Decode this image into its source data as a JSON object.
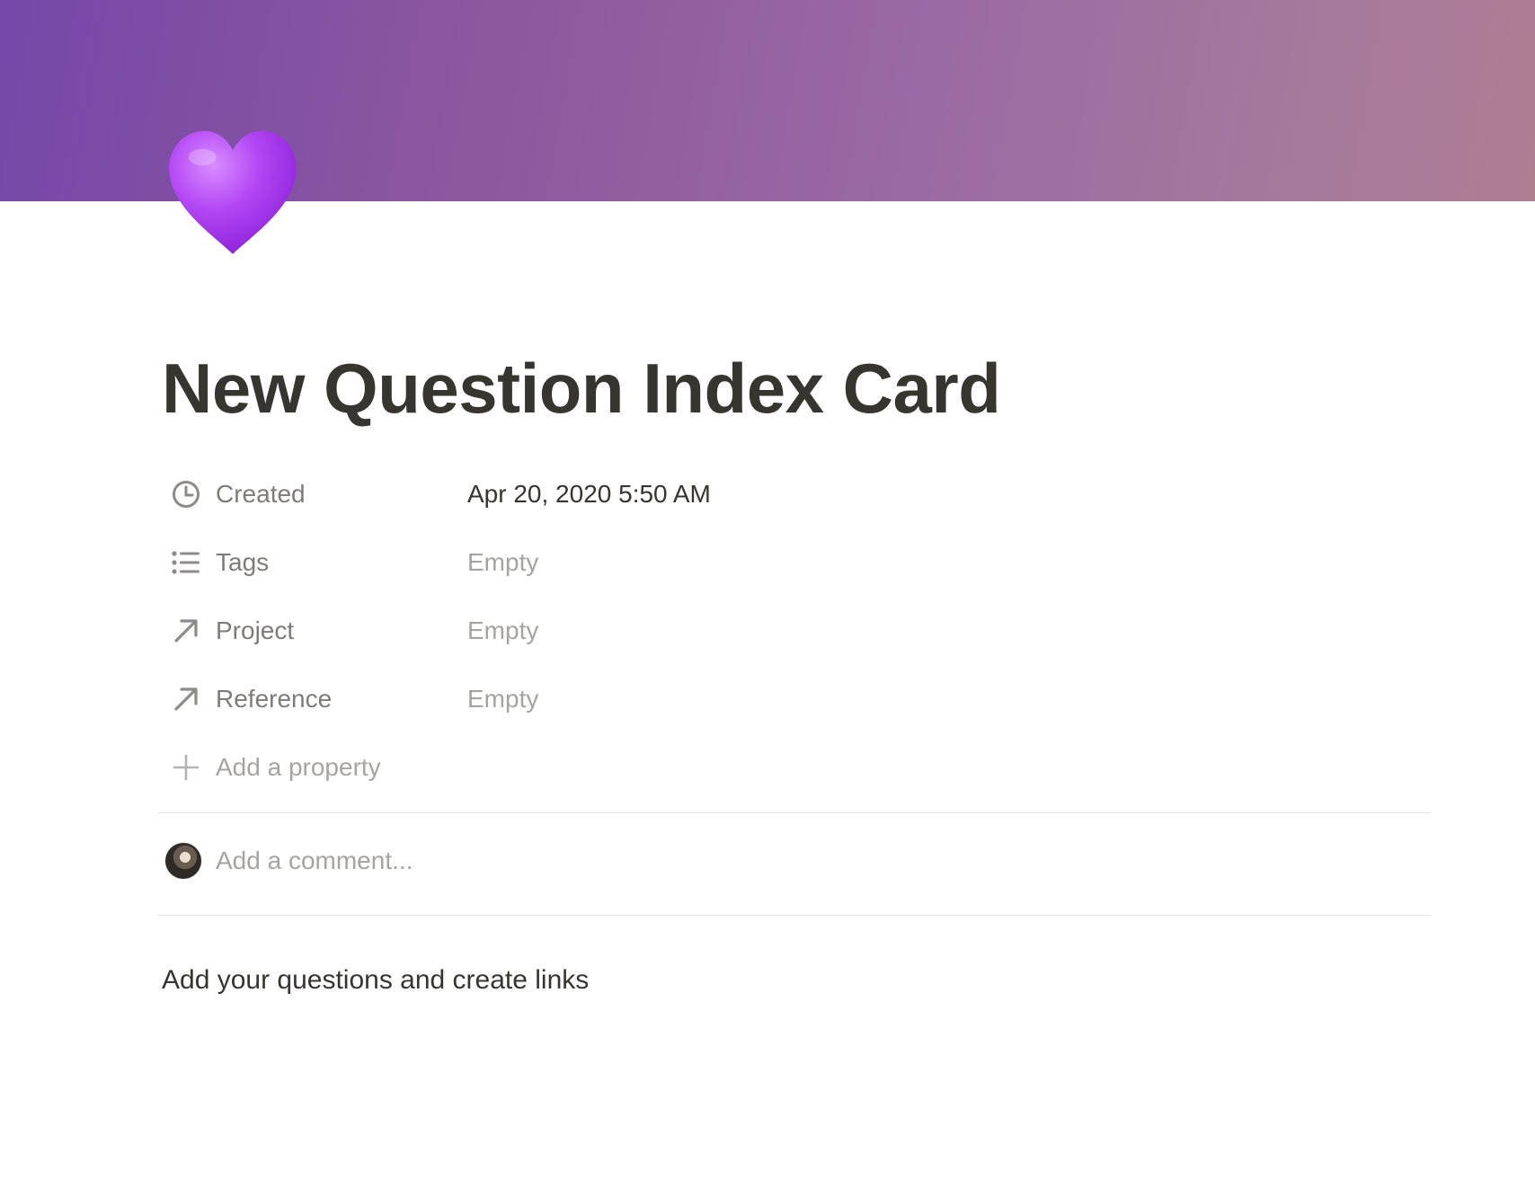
{
  "page": {
    "title": "New Question Index Card",
    "icon": "purple-heart-icon"
  },
  "properties": [
    {
      "label": "Created",
      "value": "Apr 20, 2020 5:50 AM",
      "icon": "clock-icon"
    },
    {
      "label": "Tags",
      "value": "Empty",
      "icon": "list-icon"
    },
    {
      "label": "Project",
      "value": "Empty",
      "icon": "arrow-up-right-icon"
    },
    {
      "label": "Reference",
      "value": "Empty",
      "icon": "arrow-up-right-icon"
    }
  ],
  "add_property": {
    "label": "Add a property",
    "icon": "plus-icon"
  },
  "comment": {
    "placeholder": "Add a comment..."
  },
  "body": {
    "text": "Add your questions and create links"
  },
  "colors": {
    "cover_start": "#7548a9",
    "cover_end": "#b07d92",
    "heart": "#a83cf0",
    "text": "#37352f",
    "muted": "#7d7c78",
    "placeholder": "#a5a4a0"
  }
}
